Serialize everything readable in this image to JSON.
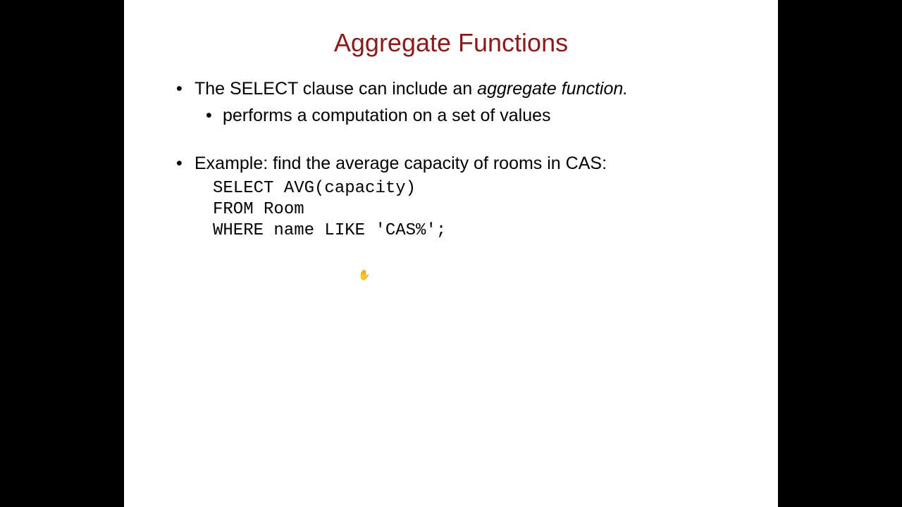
{
  "slide": {
    "title": "Aggregate Functions",
    "bullet1_pre": "The SELECT clause can include an ",
    "bullet1_italic": "aggregate function.",
    "bullet1_sub": "performs a computation on a set of values",
    "bullet2": "Example: find the average capacity of rooms in CAS:",
    "code": "SELECT AVG(capacity)\nFROM Room\nWHERE name LIKE 'CAS%';"
  },
  "cursor_glyph": "✋"
}
